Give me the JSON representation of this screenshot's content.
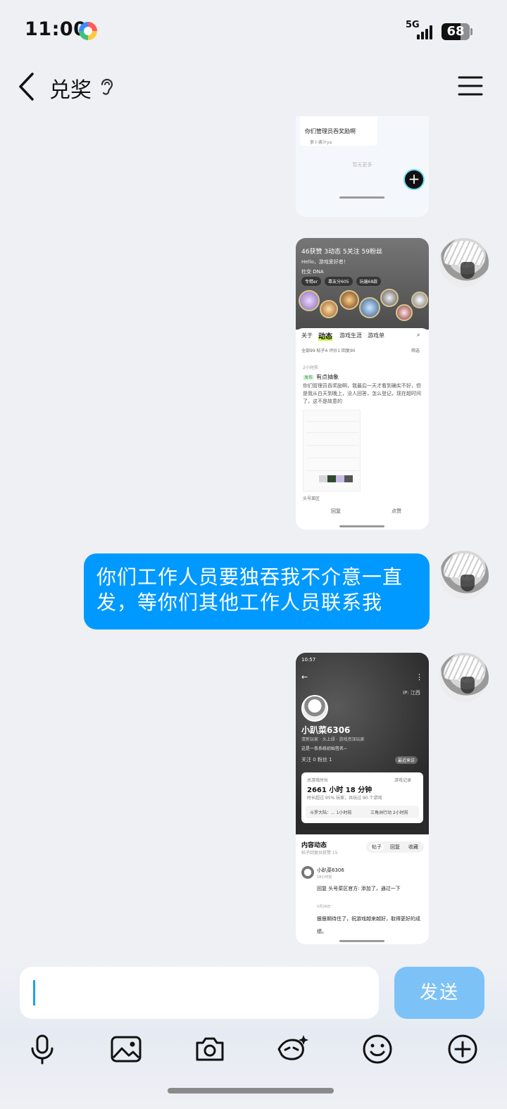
{
  "status_bar": {
    "time": "11:00",
    "network": "5G",
    "battery": "68"
  },
  "nav": {
    "title": "兑奖"
  },
  "messages": {
    "shot1": {
      "post_text": "你们管理员吞奖励啊",
      "user": "萝卜酱汁ya",
      "no_more": "暂无更多"
    },
    "shot2": {
      "stats": "46获赞  3动态  5关注  59粉丝",
      "hero_title": "Hello，游戏爱好者！",
      "hero_tag": "社交 DNA",
      "chips": [
        "专精er",
        "靠友分605",
        "玩遍68款"
      ],
      "tabs": [
        "关于",
        "动态",
        "游戏生涯",
        "游戏单"
      ],
      "subtabs": "全部99  帖子4  评价1  回复90",
      "filter": "筛选",
      "post_time": "2小时前",
      "post_tag": "发布",
      "post_title": "有点抽象",
      "post_body": "你们管理员吞奖励啊，我最后一天才看到确实不好，但是我从白天到晚上，没人回答，怎么登记，现在超时间了，这不是故意的",
      "draft": "头号菜区",
      "reply_btn": "回复",
      "like_btn": "点赞"
    },
    "text_bubble": "你们工作人员要独吞我不介意一直发，等你们其他工作人员联系我",
    "shot3": {
      "time": "10:57",
      "ip": "IP: 江西",
      "name": "小趴菜6306",
      "badges": "清新玩家  · 头上绿  · 游戏资深玩家",
      "bio": "这是一条系统初始签名~",
      "follow": "关注 0   粉丝 1",
      "recent": "最近来访",
      "card_label": "总游戏时长",
      "card_record": "游戏记录",
      "hours": "2661 小时 18 分钟",
      "beat": "时长超过 95% 玩家，共玩过 90 个游戏",
      "game1": "斗罗大陆：... 1小时前",
      "game2": "三角洲行动 2小时前",
      "section_title": "内容动态",
      "section_sub": "帖子回复共获赞 15",
      "segments": [
        "帖子",
        "回复",
        "收藏"
      ],
      "user_name": "小趴菜6306",
      "user_time": "18小时前",
      "reply1": "回复 头号菜区官方: 添加了，通过一下",
      "date2": "5月26日",
      "reply2": "狠狠期待住了，祝游戏越来越好，取得更好的成绩。"
    }
  },
  "input": {
    "placeholder": "",
    "send_label": "发送"
  },
  "toolbar": {
    "icons": [
      "microphone-icon",
      "image-icon",
      "camera-icon",
      "ai-assistant-icon",
      "emoji-icon",
      "plus-icon"
    ]
  },
  "colors": {
    "bubble": "#0099ff",
    "send_disabled": "#7cc2f7",
    "background": "#eef0f4"
  }
}
